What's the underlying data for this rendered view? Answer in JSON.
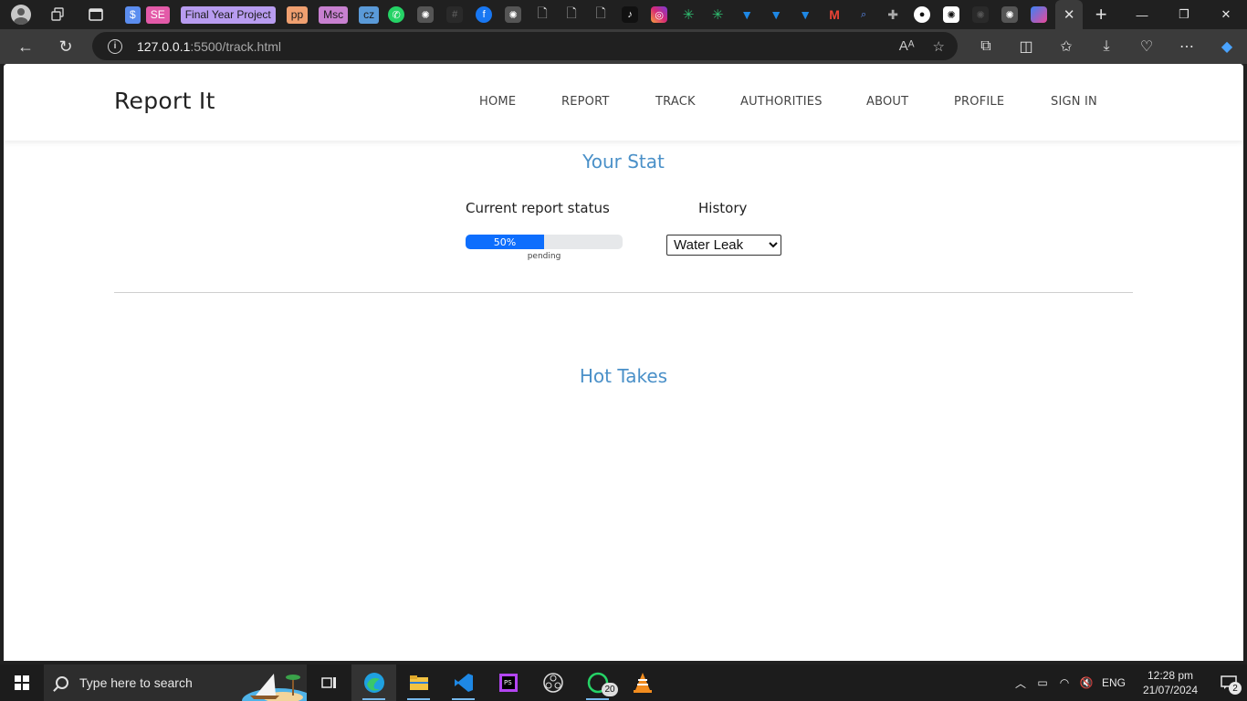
{
  "browser": {
    "tabs": [
      {
        "name": "bookmark-dollar",
        "label": "$",
        "color": "#5b8def"
      },
      {
        "name": "bookmark-se",
        "label": "SE",
        "color": "#e35aa8"
      },
      {
        "name": "bookmark-final-year",
        "label": "Final Year Project",
        "color": "#b89cf0"
      },
      {
        "name": "bookmark-pp",
        "label": "pp",
        "color": "#f0a070"
      },
      {
        "name": "bookmark-msc",
        "label": "Msc",
        "color": "#c880d0"
      },
      {
        "name": "bookmark-cz",
        "label": "cz",
        "color": "#5a9ad8"
      }
    ],
    "url_host": "127.0.0.1",
    "url_path": ":5500/track.html",
    "new_tab": "+"
  },
  "site": {
    "brand": "Report It",
    "nav": [
      "HOME",
      "REPORT",
      "TRACK",
      "AUTHORITIES",
      "ABOUT",
      "PROFILE",
      "SIGN IN"
    ]
  },
  "stat": {
    "title": "Your Stat",
    "current_label": "Current report status",
    "progress_value": 0.5,
    "progress_text": "50%",
    "status": "pending",
    "history_label": "History",
    "history_selected": "Water Leak"
  },
  "hot_takes": {
    "title": "Hot Takes"
  },
  "taskbar": {
    "search_placeholder": "Type here to search",
    "whatsapp_badge": "20",
    "language": "ENG",
    "time": "12:28 pm",
    "date": "21/07/2024",
    "notification_count": "2"
  },
  "colors": {
    "accent_title": "#4a90c8",
    "progress_fill": "#0d6efd",
    "progress_track": "#e6e8ea"
  }
}
